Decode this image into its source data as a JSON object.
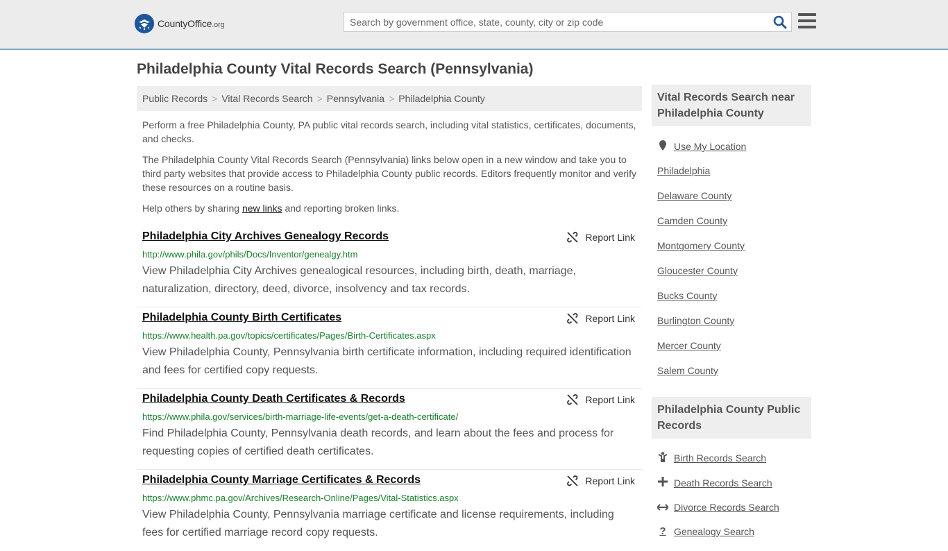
{
  "header": {
    "logo_text": "CountyOffice",
    "logo_tld": ".org",
    "search_placeholder": "Search by government office, state, county, city or zip code",
    "brand_color": "#1e5799"
  },
  "page_title": "Philadelphia County Vital Records Search (Pennsylvania)",
  "breadcrumb": [
    {
      "label": "Public Records"
    },
    {
      "label": "Vital Records Search"
    },
    {
      "label": "Pennsylvania"
    },
    {
      "label": "Philadelphia County"
    }
  ],
  "intro": {
    "p1": "Perform a free Philadelphia County, PA public vital records search, including vital statistics, certificates, documents, and checks.",
    "p2": "The Philadelphia County Vital Records Search (Pennsylvania) links below open in a new window and take you to third party websites that provide access to Philadelphia County public records. Editors frequently monitor and verify these resources on a routine basis.",
    "p3_before": "Help others by sharing ",
    "p3_link": "new links",
    "p3_after": " and reporting broken links."
  },
  "report_label": "Report Link",
  "results": [
    {
      "title": "Philadelphia City Archives Genealogy Records",
      "url": "http://www.phila.gov/phils/Docs/Inventor/genealgy.htm",
      "desc": "View Philadelphia City Archives genealogical resources, including birth, death, marriage, naturalization, directory, deed, divorce, insolvency and tax records."
    },
    {
      "title": "Philadelphia County Birth Certificates",
      "url": "https://www.health.pa.gov/topics/certificates/Pages/Birth-Certificates.aspx",
      "desc": "View Philadelphia County, Pennsylvania birth certificate information, including required identification and fees for certified copy requests."
    },
    {
      "title": "Philadelphia County Death Certificates & Records",
      "url": "https://www.phila.gov/services/birth-marriage-life-events/get-a-death-certificate/",
      "desc": "Find Philadelphia County, Pennsylvania death records, and learn about the fees and process for requesting copies of certified death certificates."
    },
    {
      "title": "Philadelphia County Marriage Certificates & Records",
      "url": "https://www.phmc.pa.gov/Archives/Research-Online/Pages/Vital-Statistics.aspx",
      "desc": "View Philadelphia County, Pennsylvania marriage certificate and license requirements, including fees for certified marriage record copy requests."
    }
  ],
  "sidebar": {
    "nearby_heading": "Vital Records Search near Philadelphia County",
    "use_location": "Use My Location",
    "nearby": [
      "Philadelphia",
      "Delaware County",
      "Camden County",
      "Montgomery County",
      "Gloucester County",
      "Bucks County",
      "Burlington County",
      "Mercer County",
      "Salem County"
    ],
    "public_heading": "Philadelphia County Public Records",
    "public_links": [
      {
        "label": "Birth Records Search",
        "icon": "child-icon"
      },
      {
        "label": "Death Records Search",
        "icon": "cross-icon"
      },
      {
        "label": "Divorce Records Search",
        "icon": "arrows-icon"
      },
      {
        "label": "Genealogy Search",
        "icon": "question-icon"
      }
    ]
  }
}
